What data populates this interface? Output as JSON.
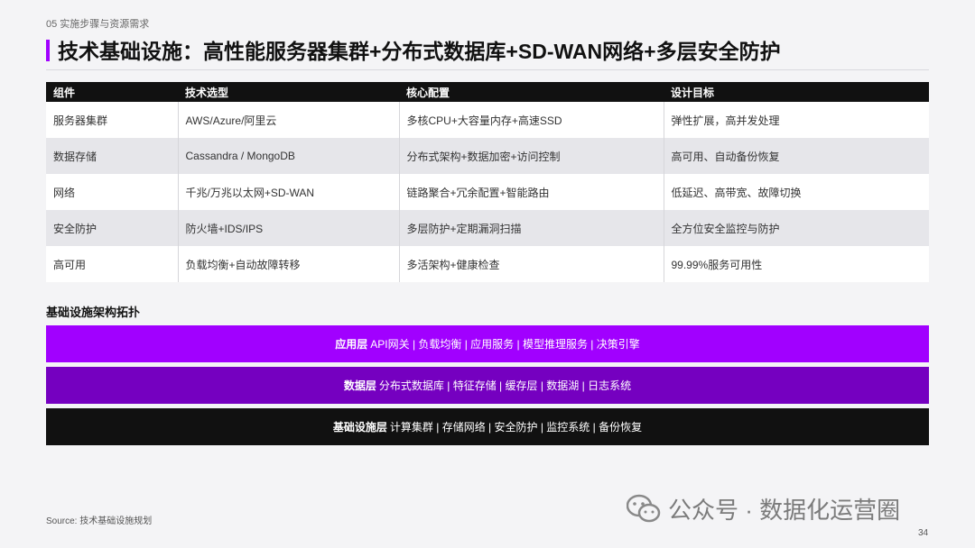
{
  "header": {
    "section": "05 实施步骤与资源需求",
    "title": "技术基础设施：高性能服务器集群+分布式数据库+SD-WAN网络+多层安全防护"
  },
  "table": {
    "headers": [
      "组件",
      "技术选型",
      "核心配置",
      "设计目标"
    ],
    "rows": [
      [
        "服务器集群",
        "AWS/Azure/阿里云",
        "多核CPU+大容量内存+高速SSD",
        "弹性扩展，高并发处理"
      ],
      [
        "数据存储",
        "Cassandra / MongoDB",
        "分布式架构+数据加密+访问控制",
        "高可用、自动备份恢复"
      ],
      [
        "网络",
        "千兆/万兆以太网+SD-WAN",
        "链路聚合+冗余配置+智能路由",
        "低延迟、高带宽、故障切换"
      ],
      [
        "安全防护",
        "防火墙+IDS/IPS",
        "多层防护+定期漏洞扫描",
        "全方位安全监控与防护"
      ],
      [
        "高可用",
        "负载均衡+自动故障转移",
        "多活架构+健康检查",
        "99.99%服务可用性"
      ]
    ]
  },
  "architecture": {
    "heading": "基础设施架构拓扑",
    "layers": [
      {
        "name": "应用层",
        "items": "API网关 | 负载均衡 | 应用服务 | 模型推理服务 | 决策引擎",
        "color": "#a100ff"
      },
      {
        "name": "数据层",
        "items": "分布式数据库 | 特征存储 | 缓存层 | 数据湖 | 日志系统",
        "color": "#7500c0"
      },
      {
        "name": "基础设施层",
        "items": "计算集群 | 存储网络 | 安全防护 | 监控系统 | 备份恢复",
        "color": "#111111"
      }
    ]
  },
  "footer": {
    "source": "Source: 技术基础设施规划",
    "watermark": "公众号 · 数据化运营圈",
    "page": "34"
  },
  "colors": {
    "accent": "#a100ff",
    "accent_dark": "#7500c0"
  }
}
